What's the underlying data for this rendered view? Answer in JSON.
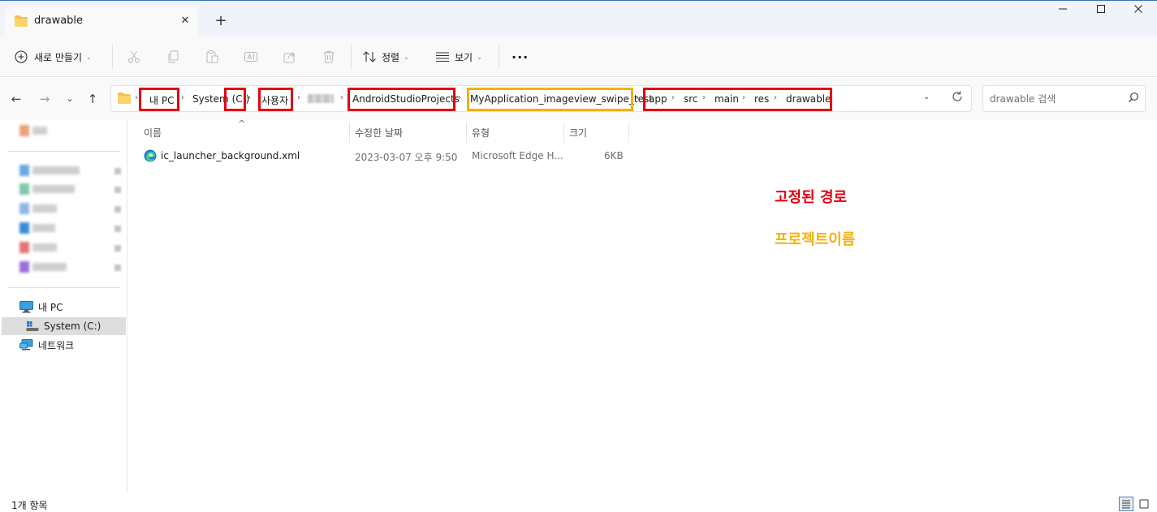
{
  "window": {
    "tab_title": "drawable",
    "new_tab": "+",
    "controls": {
      "minimize": "—",
      "maximize": "☐",
      "close": "✕"
    }
  },
  "toolbar": {
    "new_label": "새로 만들기",
    "sort_label": "정렬",
    "view_label": "보기",
    "more_label": "···"
  },
  "address": {
    "crumbs": [
      "내 PC",
      "System (C:)",
      "사용자",
      "AndroidStudioProjects",
      "MyApplication_imageview_swipe_test",
      "app",
      "src",
      "main",
      "res",
      "drawable"
    ]
  },
  "search": {
    "placeholder": "drawable 검색"
  },
  "sidebar": {
    "items": [
      {
        "label": "내 PC",
        "icon": "monitor-icon"
      },
      {
        "label": "System (C:)",
        "icon": "drive-icon",
        "selected": true
      },
      {
        "label": "네트워크",
        "icon": "network-icon"
      }
    ]
  },
  "columns": {
    "name": "이름",
    "modified": "수정한 날짜",
    "type": "유형",
    "size": "크기"
  },
  "files": [
    {
      "name": "ic_launcher_background.xml",
      "modified": "2023-03-07 오후 9:50",
      "type": "Microsoft Edge H...",
      "size": "6KB",
      "icon": "edge-icon"
    }
  ],
  "annotations": {
    "fixed_path": "고정된 경로",
    "project_name": "프로젝트이름",
    "fixed_color": "#e3000f",
    "project_color": "#f2b10d"
  },
  "status": {
    "item_count": "1개 항목"
  }
}
